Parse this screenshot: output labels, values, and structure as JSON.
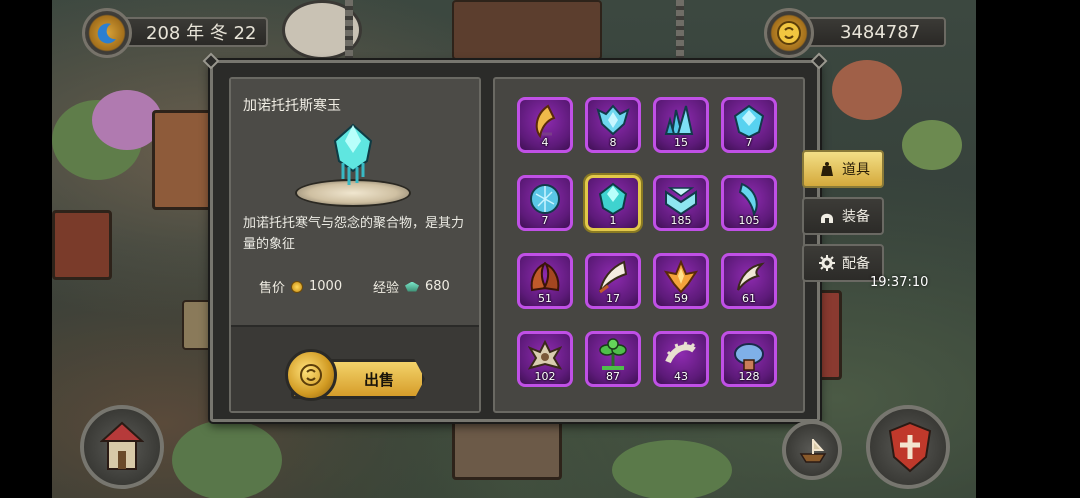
{
  "hud": {
    "date": "208 年 冬 22",
    "gold": "3484787"
  },
  "item_detail": {
    "name": "加诺托托斯寒玉",
    "description": "加诺托托寒气与怨念的聚合物，是其力量的象征",
    "price_label": "售价",
    "price_value": "1000",
    "exp_label": "经验",
    "exp_value": "680",
    "sell_label": "出售"
  },
  "inventory": [
    {
      "icon": "horn-fang-icon",
      "count": "4"
    },
    {
      "icon": "ice-crystal-crown-icon",
      "count": "8"
    },
    {
      "icon": "ice-shard-cluster-icon",
      "count": "15"
    },
    {
      "icon": "frost-gem-icon",
      "count": "7"
    },
    {
      "icon": "frost-orb-icon",
      "count": "7"
    },
    {
      "icon": "cold-jade-icon",
      "count": "1"
    },
    {
      "icon": "ice-chevron-icon",
      "count": "185"
    },
    {
      "icon": "ice-fang-icon",
      "count": "105"
    },
    {
      "icon": "demon-horns-icon",
      "count": "51"
    },
    {
      "icon": "curved-claw-icon",
      "count": "17"
    },
    {
      "icon": "amber-crystal-icon",
      "count": "59"
    },
    {
      "icon": "bone-claw-icon",
      "count": "61"
    },
    {
      "icon": "spiked-shell-icon",
      "count": "102"
    },
    {
      "icon": "herb-leaf-icon",
      "count": "87"
    },
    {
      "icon": "bone-spine-icon",
      "count": "43"
    },
    {
      "icon": "blue-cap-icon",
      "count": "128"
    }
  ],
  "side_tabs": [
    {
      "label": "道具",
      "icon": "pouch-icon",
      "active": true
    },
    {
      "label": "装备",
      "icon": "helmet-icon",
      "active": false
    },
    {
      "label": "配备",
      "icon": "gear-icon",
      "active": false
    }
  ],
  "clock": "19:37:10",
  "colors": {
    "slot_border": "#c050e6",
    "selected_border": "#e2c84a",
    "active_tab": "#f3df86",
    "sell_button": "#f3d36a"
  }
}
